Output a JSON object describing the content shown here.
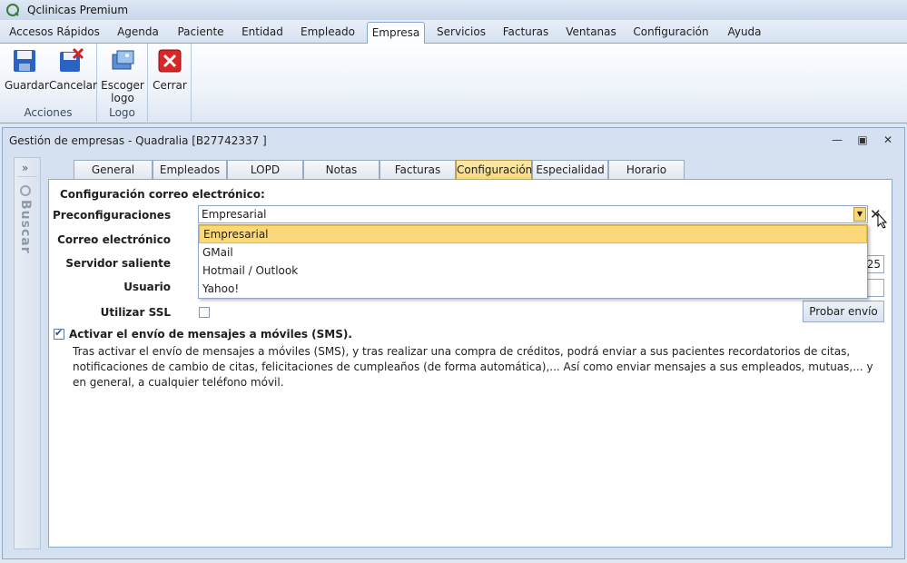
{
  "window": {
    "title": "Qclinicas Premium"
  },
  "menu": {
    "tabs": [
      "Accesos Rápidos",
      "Agenda",
      "Paciente",
      "Entidad",
      "Empleado",
      "Empresa",
      "Servicios",
      "Facturas",
      "Ventanas",
      "Configuración",
      "Ayuda"
    ],
    "active": "Empresa"
  },
  "ribbon": {
    "groups": {
      "acciones": {
        "label": "Acciones",
        "guardar": "Guardar",
        "cancelar": "Cancelar"
      },
      "logo": {
        "label": "Logo",
        "escoger_line1": "Escoger",
        "escoger_line2": "logo"
      },
      "cerrar": {
        "label": "Cerrar"
      }
    }
  },
  "document": {
    "title": "Gestión de empresas - Quadralia  [B27742337 ]",
    "sidebar_label": "Buscar"
  },
  "form_tabs": [
    "General",
    "Empleados",
    "LOPD",
    "Notas",
    "Facturas",
    "Configuración",
    "Especialidad",
    "Horario"
  ],
  "form_tabs_active": "Configuración",
  "form": {
    "section_title": "Configuración correo electrónico:",
    "labels": {
      "preconfig": "Preconfiguraciones",
      "email": "Correo electrónico",
      "server": "Servidor saliente",
      "user": "Usuario",
      "ssl": "Utilizar SSL"
    },
    "preconfig_value": "Empresarial",
    "dropdown_options": [
      "Empresarial",
      "GMail",
      "Hotmail / Outlook",
      "Yahoo!"
    ],
    "dropdown_selected": "Empresarial",
    "port_value": "25",
    "ssl_checked": false,
    "test_button": "Probar envío",
    "sms_checked": true,
    "sms_label": "Activar el envío de mensajes a móviles (SMS).",
    "sms_description": "Tras activar el envío de mensajes a móviles (SMS), y tras realizar una compra de créditos, podrá enviar a sus pacientes recordatorios de citas, notificaciones de cambio de citas, felicitaciones de cumpleaños (de forma automática),... Así como enviar mensajes a sus empleados, mutuas,... y en general, a cualquier teléfono móvil."
  },
  "colors": {
    "accent": "#f8d878",
    "frame": "#8ea8c9",
    "ribbon": "#dde7f3"
  }
}
